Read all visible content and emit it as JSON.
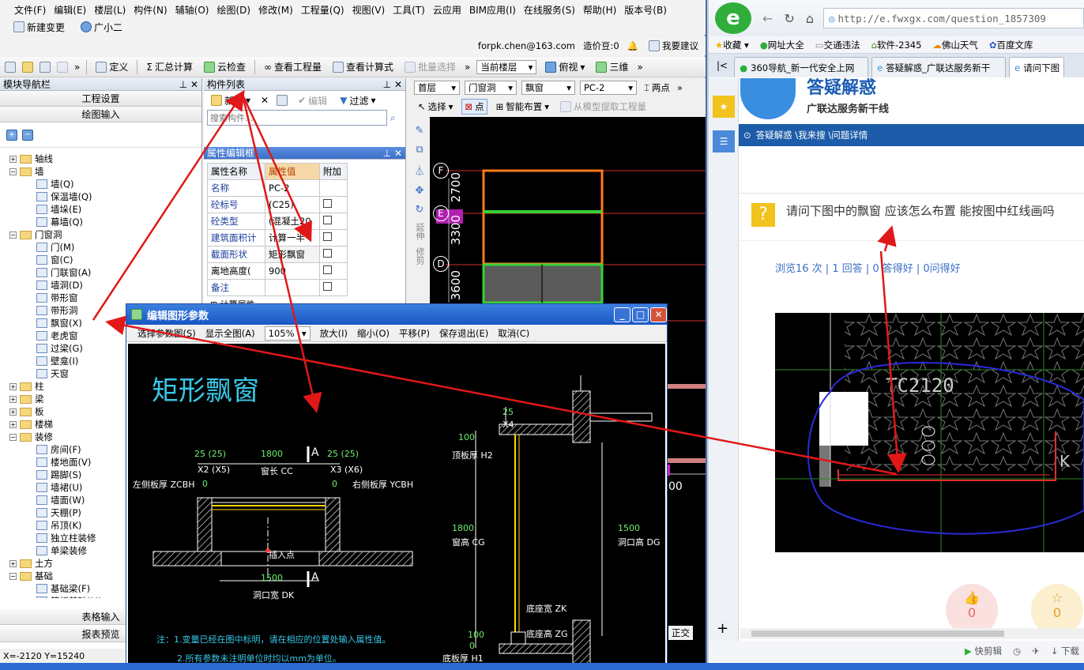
{
  "app": {
    "menu": [
      "文件(F)",
      "编辑(E)",
      "楼层(L)",
      "构件(N)",
      "辅轴(O)",
      "绘图(D)",
      "修改(M)",
      "工程量(Q)",
      "视图(V)",
      "工具(T)",
      "云应用",
      "BIM应用(I)",
      "在线服务(S)",
      "帮助(H)",
      "版本号(B)"
    ],
    "new_change": "新建变更",
    "guangxiaoer": "广小二",
    "account": "forpk.chen@163.com",
    "price_bean": "造价豆:0",
    "suggest": "我要建议",
    "toolbar": [
      "定义",
      "汇总计算",
      "云检查",
      "查看工程量",
      "查看计算式",
      "批量选择"
    ],
    "current_floor": "当前楼层",
    "view_mode": "俯视",
    "three_d": "三维",
    "nav_title": "模块导航栏",
    "project_settings": "工程设置",
    "drawing_input": "绘图输入",
    "table_input": "表格输入",
    "report_preview": "报表预览",
    "tree": [
      {
        "label": "轴线",
        "type": "folder",
        "open": false
      },
      {
        "label": "墙",
        "type": "folder",
        "open": true
      },
      {
        "label": "墙(Q)",
        "type": "leaf"
      },
      {
        "label": "保温墙(Q)",
        "type": "leaf"
      },
      {
        "label": "墙垛(E)",
        "type": "leaf"
      },
      {
        "label": "幕墙(Q)",
        "type": "leaf"
      },
      {
        "label": "门窗洞",
        "type": "folder",
        "open": true
      },
      {
        "label": "门(M)",
        "type": "leaf"
      },
      {
        "label": "窗(C)",
        "type": "leaf"
      },
      {
        "label": "门联窗(A)",
        "type": "leaf"
      },
      {
        "label": "墙洞(D)",
        "type": "leaf"
      },
      {
        "label": "带形窗",
        "type": "leaf"
      },
      {
        "label": "带形洞",
        "type": "leaf"
      },
      {
        "label": "飘窗(X)",
        "type": "leaf"
      },
      {
        "label": "老虎窗",
        "type": "leaf"
      },
      {
        "label": "过梁(G)",
        "type": "leaf"
      },
      {
        "label": "壁龛(I)",
        "type": "leaf"
      },
      {
        "label": "天窗",
        "type": "leaf"
      },
      {
        "label": "柱",
        "type": "folder",
        "open": false
      },
      {
        "label": "梁",
        "type": "folder",
        "open": false
      },
      {
        "label": "板",
        "type": "folder",
        "open": false
      },
      {
        "label": "楼梯",
        "type": "folder",
        "open": false
      },
      {
        "label": "装修",
        "type": "folder",
        "open": true
      },
      {
        "label": "房间(F)",
        "type": "leaf"
      },
      {
        "label": "楼地面(V)",
        "type": "leaf"
      },
      {
        "label": "踢脚(S)",
        "type": "leaf"
      },
      {
        "label": "墙裙(U)",
        "type": "leaf"
      },
      {
        "label": "墙面(W)",
        "type": "leaf"
      },
      {
        "label": "天棚(P)",
        "type": "leaf"
      },
      {
        "label": "吊顶(K)",
        "type": "leaf"
      },
      {
        "label": "独立柱装修",
        "type": "leaf"
      },
      {
        "label": "单梁装修",
        "type": "leaf"
      },
      {
        "label": "土方",
        "type": "folder",
        "open": false
      },
      {
        "label": "基础",
        "type": "folder",
        "open": true
      },
      {
        "label": "基础梁(F)",
        "type": "leaf"
      },
      {
        "label": "筏板基础(M)",
        "type": "leaf"
      }
    ],
    "comp_title": "构件列表",
    "comp_new": "新建",
    "comp_edit": "编辑",
    "comp_filter": "过滤",
    "search_placeholder": "搜索构件...",
    "props_title": "属性编辑框",
    "props_headers": [
      "属性名称",
      "属性值",
      "附加"
    ],
    "props": [
      {
        "name": "名称",
        "value": "PC-2"
      },
      {
        "name": "砼标号",
        "value": "(C25)"
      },
      {
        "name": "砼类型",
        "value": "(混凝土20"
      },
      {
        "name": "建筑面积计",
        "value": "计算一半"
      },
      {
        "name": "截面形状",
        "value": "矩形飘窗"
      },
      {
        "name": "离地高度(",
        "value": "900"
      },
      {
        "name": "备注",
        "value": ""
      }
    ],
    "props_more": "计算属性",
    "cadbar": {
      "floor": "首层",
      "cat": "门窗洞",
      "type": "飘窗",
      "item": "PC-2",
      "twopoint": "两点",
      "select": "选择",
      "point": "点",
      "smart": "智能布置",
      "extract": "从模型提取工程量"
    },
    "axis_labels": [
      "F",
      "E",
      "D"
    ],
    "dims": [
      "2700",
      "3300",
      "3600"
    ],
    "cad_right_text": "00",
    "status_coords": "X=-2120 Y=15240",
    "ortho": "正交"
  },
  "dialog": {
    "title": "编辑图形参数",
    "tools": [
      "选择参数图(S)",
      "显示全图(A)",
      "105%",
      "放大(I)",
      "缩小(O)",
      "平移(P)",
      "保存退出(E)",
      "取消(C)"
    ],
    "heading": "矩形飘窗",
    "labels": {
      "left_w": "25",
      "left_w2": "(25)",
      "cc_val": "1800",
      "a_top": "A",
      "right_w": "25",
      "right_w2": "(25)",
      "x2": "X2",
      "x5": "(X5)",
      "cc": "窗长 CC",
      "x3": "X3",
      "x6": "(X6)",
      "zcbh": "左侧板厚 ZCBH",
      "zcbh0": "0",
      "ycbh0": "0",
      "ycbh": "右侧板厚 YCBH",
      "insert": "插入点",
      "dk_val": "1500",
      "a_bot": "A",
      "dk": "洞口宽 DK",
      "s_25": "25",
      "s_x4": "X4",
      "s_100a": "100",
      "h2": "顶板厚 H2",
      "cg_val": "1800",
      "cg": "窗高 CG",
      "dg_val": "1500",
      "dg": "洞口高 DG",
      "zk": "底座宽 ZK",
      "s_100b": "100",
      "zg": "底座高 ZG",
      "s_0": "0",
      "h1": "底板厚 H1",
      "note1": "注：1.变量已经在图中标明，请在相应的位置处输入属性值。",
      "note2": "2.所有参数未注明单位时均以mm为单位。"
    }
  },
  "browser": {
    "url": "http://e.fwxgx.com/question_1857309",
    "fav": [
      "收藏",
      "网址大全",
      "交通违法",
      "软件-2345",
      "佛山天气",
      "百度文库"
    ],
    "tabs": [
      "360导航_新一代安全上网",
      "答疑解惑_广联达服务新干",
      "请问下图"
    ],
    "banner1": "答疑解惑",
    "banner2": "广联达服务新干线",
    "breadcrumb": "答疑解惑 \\我来搜 \\问题详情",
    "question": "请问下图中的飘窗 应该怎么布置 能按图中红线画吗",
    "stats": "浏览16 次 | 1 回答 | 0 答得好 | 0问得好",
    "img_text": "TC2120",
    "img_k": "K",
    "like_count": "0",
    "fav_count": "0",
    "quick": "快剪辑",
    "download": "下载"
  }
}
